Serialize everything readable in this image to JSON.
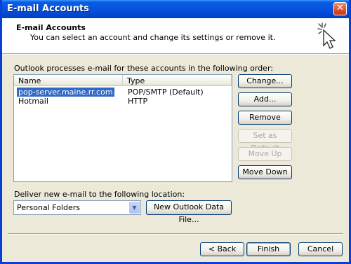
{
  "window": {
    "title": "E-mail Accounts",
    "close_symbol": "✕"
  },
  "header": {
    "title": "E-mail Accounts",
    "description": "You can select an account and change its settings or remove it.",
    "icon": "sparkle-cursor-icon"
  },
  "accounts": {
    "label": "Outlook processes e-mail for these accounts in the following order:",
    "columns": [
      "Name",
      "Type"
    ],
    "rows": [
      {
        "name": "pop-server.maine.rr.com",
        "type": "POP/SMTP (Default)",
        "selected": true
      },
      {
        "name": "Hotmail",
        "type": "HTTP",
        "selected": false
      }
    ]
  },
  "side_buttons": {
    "change": "Change...",
    "add": "Add...",
    "remove": "Remove",
    "set_default": "Set as Default",
    "move_up": "Move Up",
    "move_down": "Move Down"
  },
  "deliver": {
    "label": "Deliver new e-mail to the following location:",
    "value": "Personal Folders",
    "new_file_button": "New Outlook Data File..."
  },
  "footer": {
    "back": "< Back",
    "finish": "Finish",
    "cancel": "Cancel"
  }
}
